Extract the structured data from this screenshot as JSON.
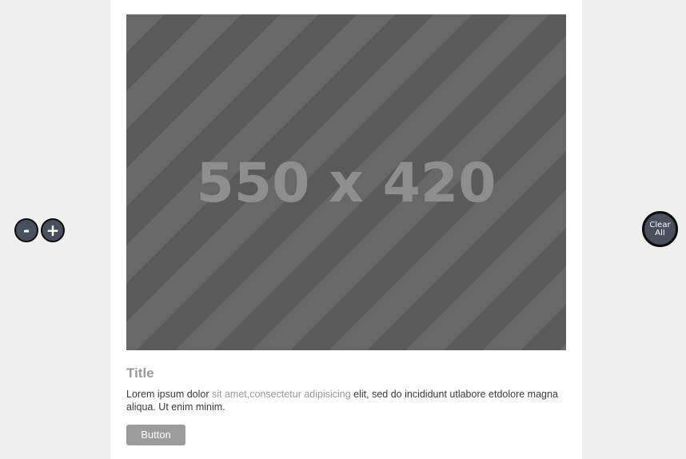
{
  "zoom_controls": {
    "zoom_out_label": "-",
    "zoom_in_label": "+"
  },
  "clear_all": {
    "line1": "Clear",
    "line2": "All"
  },
  "card": {
    "image_placeholder_text": "550 x 420",
    "title": "Title",
    "body": {
      "part1": "Lorem ipsum dolor ",
      "part2_muted": "sit amet,consectetur adipisicing",
      "part3": " elit, sed do incididunt utlabore etdolore magna aliqua. Ut enim minim."
    },
    "button_label": "Button"
  },
  "colors": {
    "page_background": "#efefef",
    "card_background": "#ffffff",
    "placeholder_dark": "#5a5a5a",
    "placeholder_light": "#686868",
    "control_button": "#4a4f5d",
    "card_button": "#9b9b9b"
  }
}
